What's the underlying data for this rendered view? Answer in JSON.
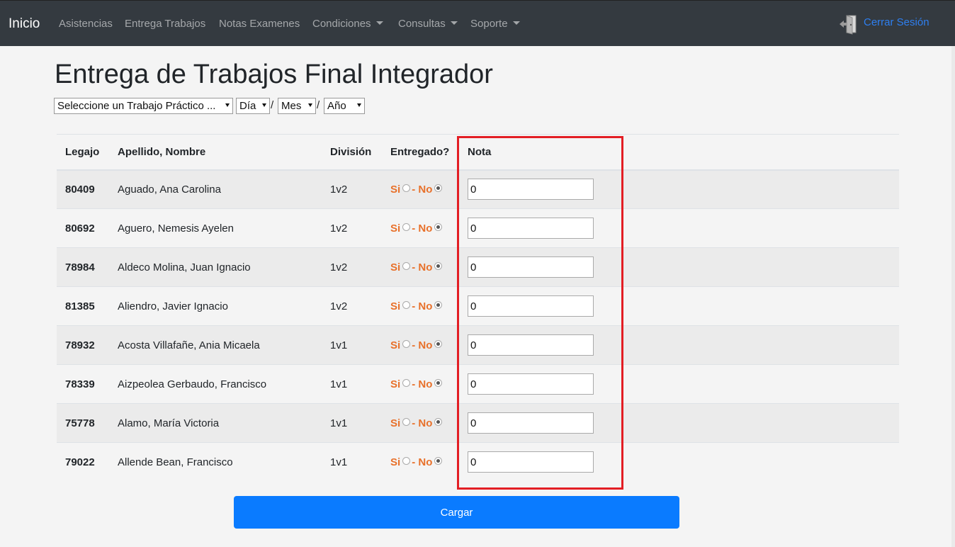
{
  "navbar": {
    "brand": "Inicio",
    "items": [
      {
        "label": "Asistencias",
        "dropdown": false
      },
      {
        "label": "Entrega Trabajos",
        "dropdown": false
      },
      {
        "label": "Notas Examenes",
        "dropdown": false
      },
      {
        "label": "Condiciones",
        "dropdown": true
      },
      {
        "label": "Consultas",
        "dropdown": true
      },
      {
        "label": "Soporte",
        "dropdown": true
      }
    ],
    "logout_icon": "logout-door-icon",
    "logout_label": "Cerrar Sesión"
  },
  "page": {
    "title": "Entrega de Trabajos Final Integrador",
    "selects": {
      "trabajo": "Seleccione un Trabajo Práctico ...",
      "dia": "Día",
      "mes": "Mes",
      "anio": "Año",
      "separator": "/"
    }
  },
  "table": {
    "headers": {
      "legajo": "Legajo",
      "nombre": "Apellido, Nombre",
      "division": "División",
      "entregado": "Entregado?",
      "nota": "Nota"
    },
    "yes_label": "Si",
    "dash_label": "- ",
    "no_label": "No",
    "rows": [
      {
        "legajo": "80409",
        "nombre": "Aguado, Ana Carolina",
        "division": "1v2",
        "entregado": "No",
        "nota": "0"
      },
      {
        "legajo": "80692",
        "nombre": "Aguero, Nemesis Ayelen",
        "division": "1v2",
        "entregado": "No",
        "nota": "0"
      },
      {
        "legajo": "78984",
        "nombre": "Aldeco Molina, Juan Ignacio",
        "division": "1v2",
        "entregado": "No",
        "nota": "0"
      },
      {
        "legajo": "81385",
        "nombre": "Aliendro, Javier Ignacio",
        "division": "1v2",
        "entregado": "No",
        "nota": "0"
      },
      {
        "legajo": "78932",
        "nombre": "Acosta Villafañe, Ania Micaela",
        "division": "1v1",
        "entregado": "No",
        "nota": "0"
      },
      {
        "legajo": "78339",
        "nombre": "Aizpeolea Gerbaudo, Francisco",
        "division": "1v1",
        "entregado": "No",
        "nota": "0"
      },
      {
        "legajo": "75778",
        "nombre": "Alamo, María Victoria",
        "division": "1v1",
        "entregado": "No",
        "nota": "0"
      },
      {
        "legajo": "79022",
        "nombre": "Allende Bean, Francisco",
        "division": "1v1",
        "entregado": "No",
        "nota": "0"
      }
    ]
  },
  "submit_label": "Cargar",
  "colors": {
    "navbar": "#343a40",
    "accent": "#0a7bff",
    "entregado_text": "#e8712b",
    "highlight_box": "#e31e24"
  }
}
